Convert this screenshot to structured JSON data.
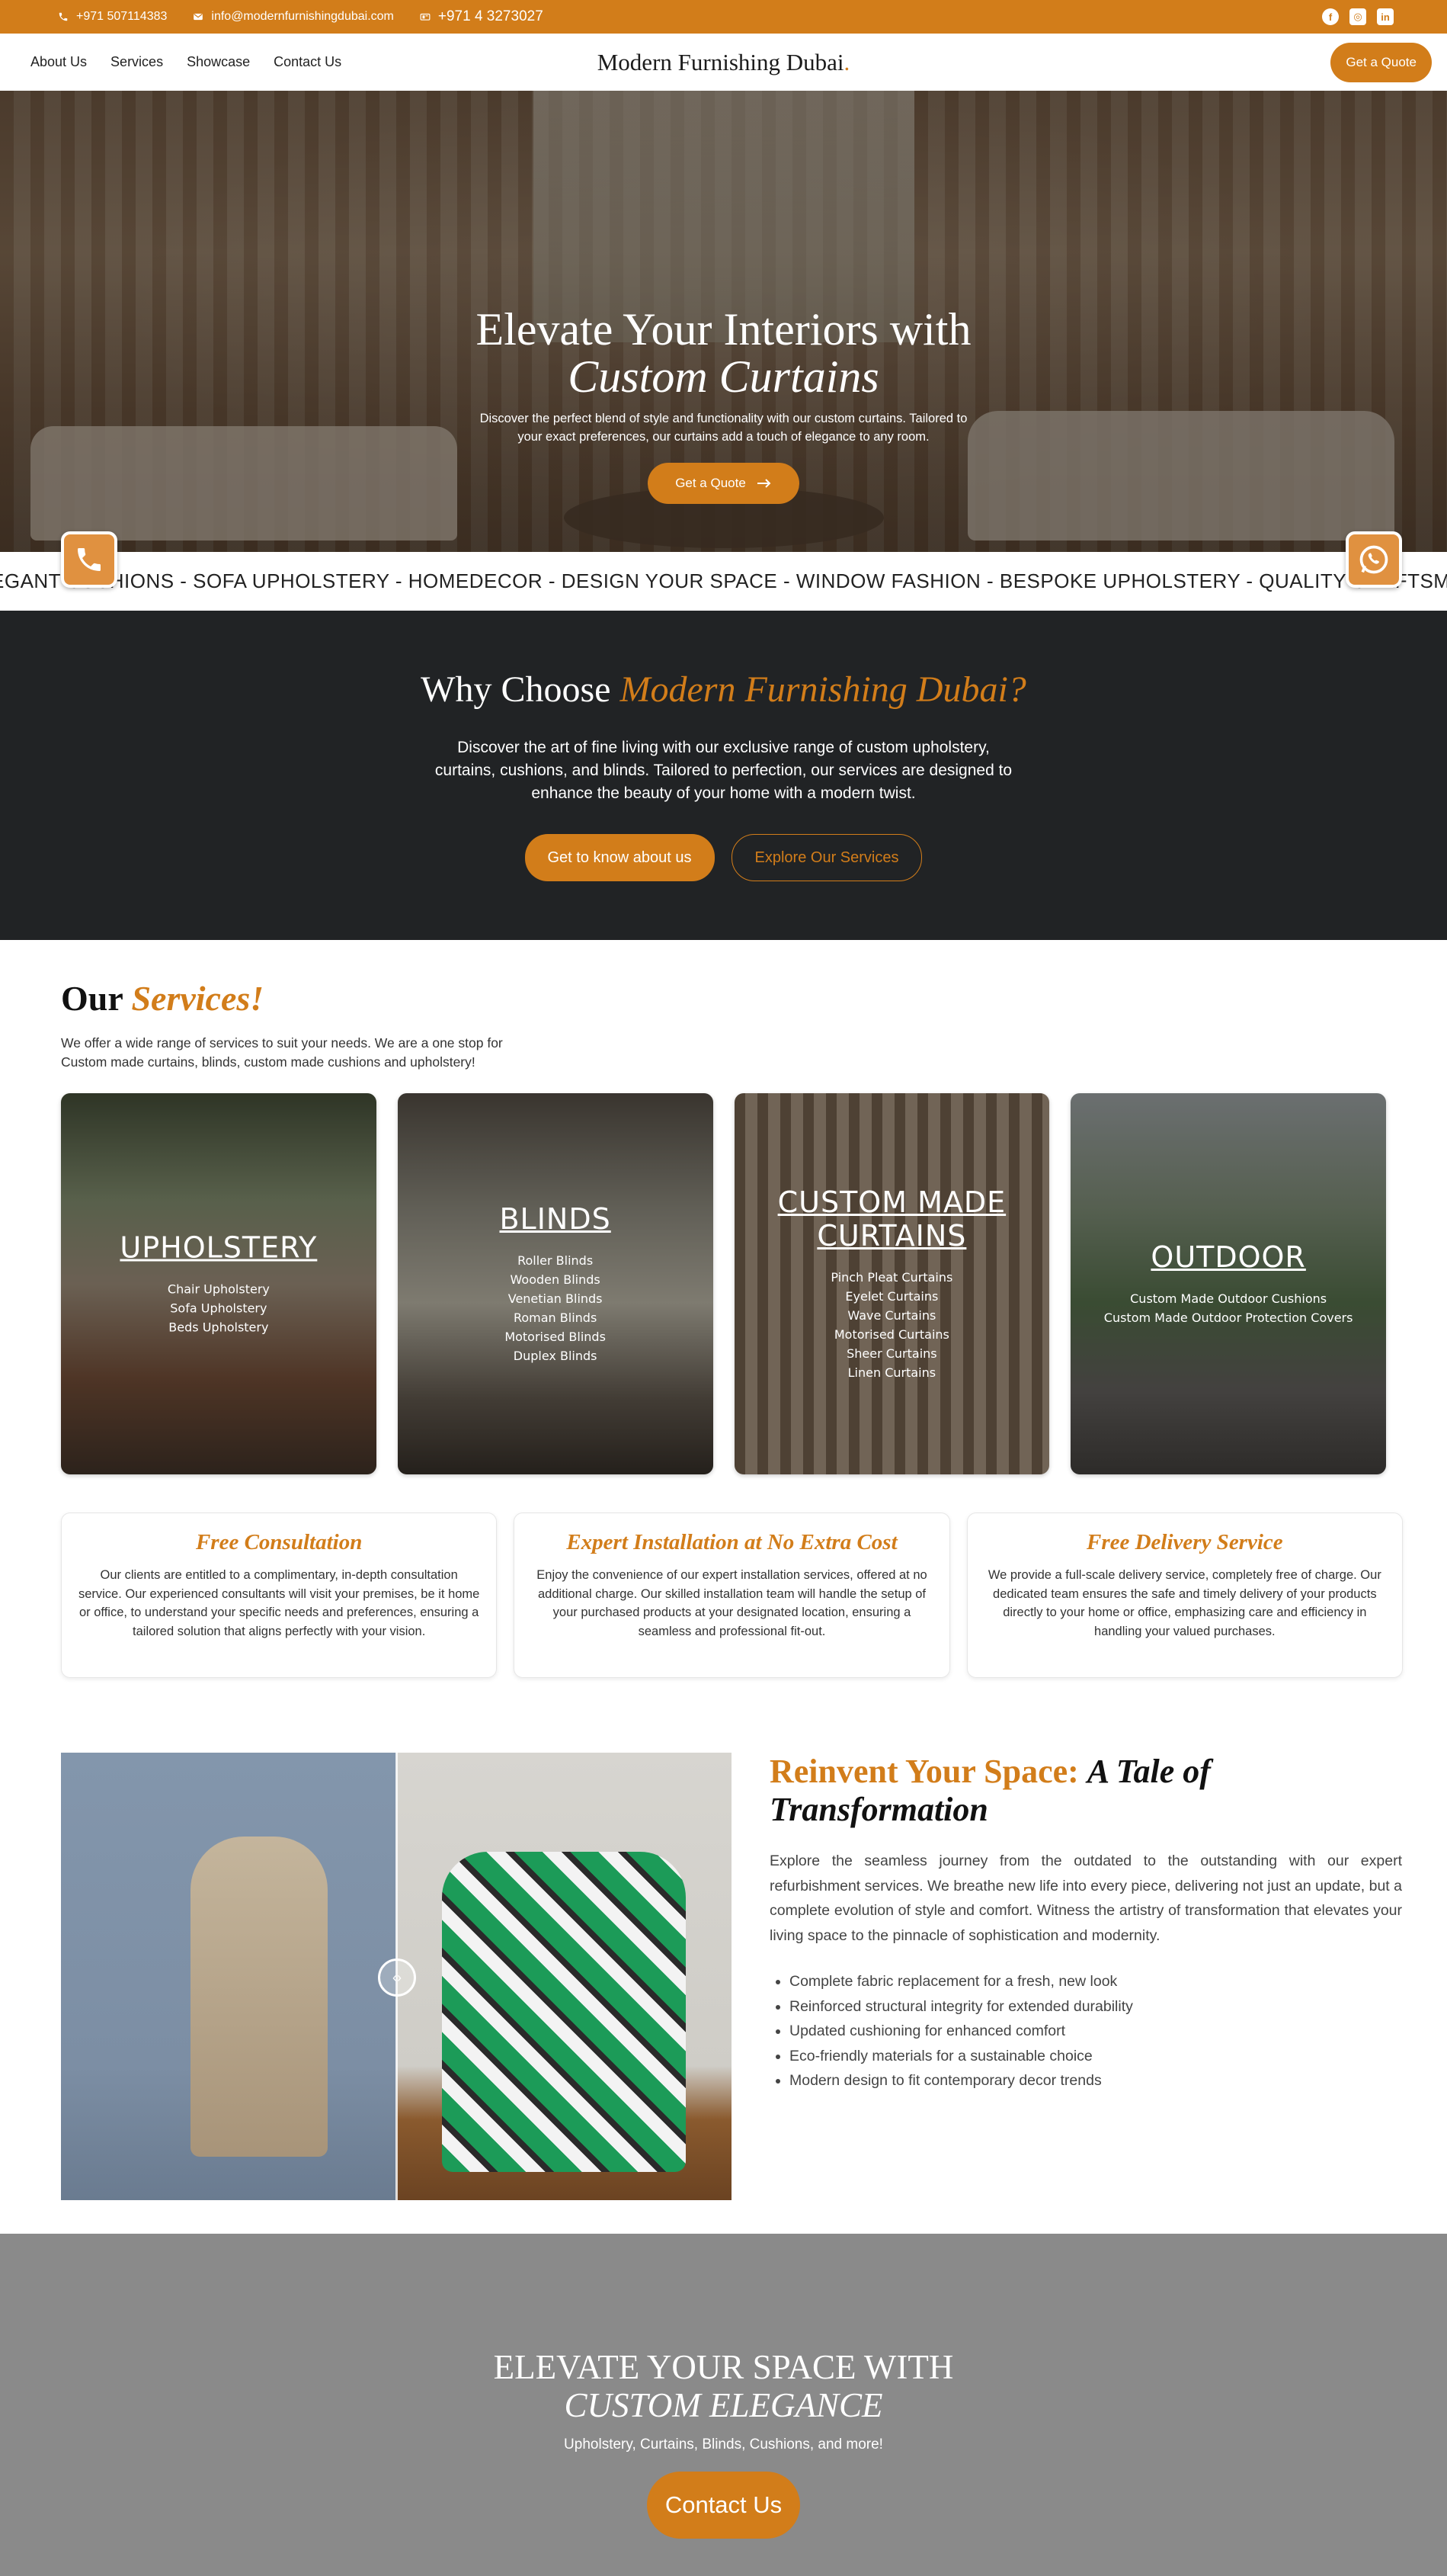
{
  "topbar": {
    "phone": "+971 507114383",
    "email": "info@modernfurnishingdubai.com",
    "landline": "+971 4 3273027",
    "social": [
      "facebook-icon",
      "instagram-icon",
      "linkedin-icon"
    ]
  },
  "nav": {
    "links": [
      "About Us",
      "Services",
      "Showcase",
      "Contact Us"
    ],
    "brand": "Modern Furnishing Dubai",
    "brand_dot": ".",
    "quote": "Get a Quote"
  },
  "hero": {
    "title_line1": "Elevate Your Interiors with",
    "title_line2": "Custom Curtains",
    "description": "Discover the perfect blend of style and functionality with our custom curtains. Tailored to your exact preferences, our curtains add a touch of elegance to any room.",
    "cta": "Get a Quote"
  },
  "marquee": {
    "text": "EGANT CUSHIONS - SOFA UPHOLSTERY - HOMEDECOR - DESIGN YOUR SPACE - WINDOW FASHION - BESPOKE UPHOLSTERY - QUALITY CRAFTSMANSHIP - TAILO"
  },
  "why": {
    "title_plain": "Why Choose",
    "title_accent": "Modern Furnishing Dubai?",
    "description": "Discover the art of fine living with our exclusive range of custom upholstery, curtains, cushions, and blinds. Tailored to perfection, our services are designed to enhance the beauty of your home with a modern twist.",
    "btn_primary": "Get to know about us",
    "btn_secondary": "Explore Our Services"
  },
  "services": {
    "title_plain": "Our",
    "title_accent": "Services!",
    "intro": "We offer a wide range of services to suit your needs. We are a one stop for Custom made curtains, blinds, custom made cushions and upholstery!",
    "cards": [
      {
        "title": "UPHOLSTERY",
        "items": [
          "Chair Upholstery",
          "Sofa Upholstery",
          "Beds Upholstery"
        ]
      },
      {
        "title": "BLINDS",
        "items": [
          "Roller Blinds",
          "Wooden Blinds",
          "Venetian Blinds",
          "Roman Blinds",
          "Motorised Blinds",
          "Duplex Blinds"
        ]
      },
      {
        "title": "CUSTOM MADE CURTAINS",
        "items": [
          "Pinch Pleat Curtains",
          "Eyelet Curtains",
          "Wave Curtains",
          "Motorised Curtains",
          "Sheer Curtains",
          "Linen Curtains"
        ]
      },
      {
        "title": "OUTDOOR",
        "items": [
          "Custom Made Outdoor Cushions",
          "Custom Made Outdoor Protection Covers"
        ]
      }
    ]
  },
  "features": [
    {
      "title": "Free Consultation",
      "text": "Our clients are entitled to a complimentary, in-depth consultation service. Our experienced consultants will visit your premises, be it home or office, to understand your specific needs and preferences, ensuring a tailored solution that aligns perfectly with your vision."
    },
    {
      "title": "Expert Installation at No Extra Cost",
      "text": "Enjoy the convenience of our expert installation services, offered at no additional charge. Our skilled installation team will handle the setup of your purchased products at your designated location, ensuring a seamless and professional fit-out."
    },
    {
      "title": "Free Delivery Service",
      "text": "We provide a full-scale delivery service, completely free of charge. Our dedicated team ensures the safe and timely delivery of your products directly to your home or office, emphasizing care and efficiency in handling your valued purchases."
    }
  ],
  "reinvent": {
    "title_accent": "Reinvent Your Space:",
    "title_italic": "A Tale of Transformation",
    "description": "Explore the seamless journey from the outdated to the outstanding with our expert refurbishment services. We breathe new life into every piece, delivering not just an update, but a complete evolution of style and comfort. Witness the artistry of transformation that elevates your living space to the pinnacle of sophistication and modernity.",
    "bullets": [
      "Complete fabric replacement for a fresh, new look",
      "Reinforced structural integrity for extended durability",
      "Updated cushioning for enhanced comfort",
      "Eco-friendly materials for a sustainable choice",
      "Modern design to fit contemporary decor trends"
    ]
  },
  "final": {
    "title_line1": "ELEVATE YOUR SPACE WITH",
    "title_line2": "CUSTOM ELEGANCE",
    "subtitle": "Upholstery, Curtains, Blinds, Cushions, and more!",
    "cta": "Contact Us"
  },
  "colors": {
    "accent": "#d27d1a",
    "dark": "#212325",
    "final_bg": "#8a8a8a"
  }
}
